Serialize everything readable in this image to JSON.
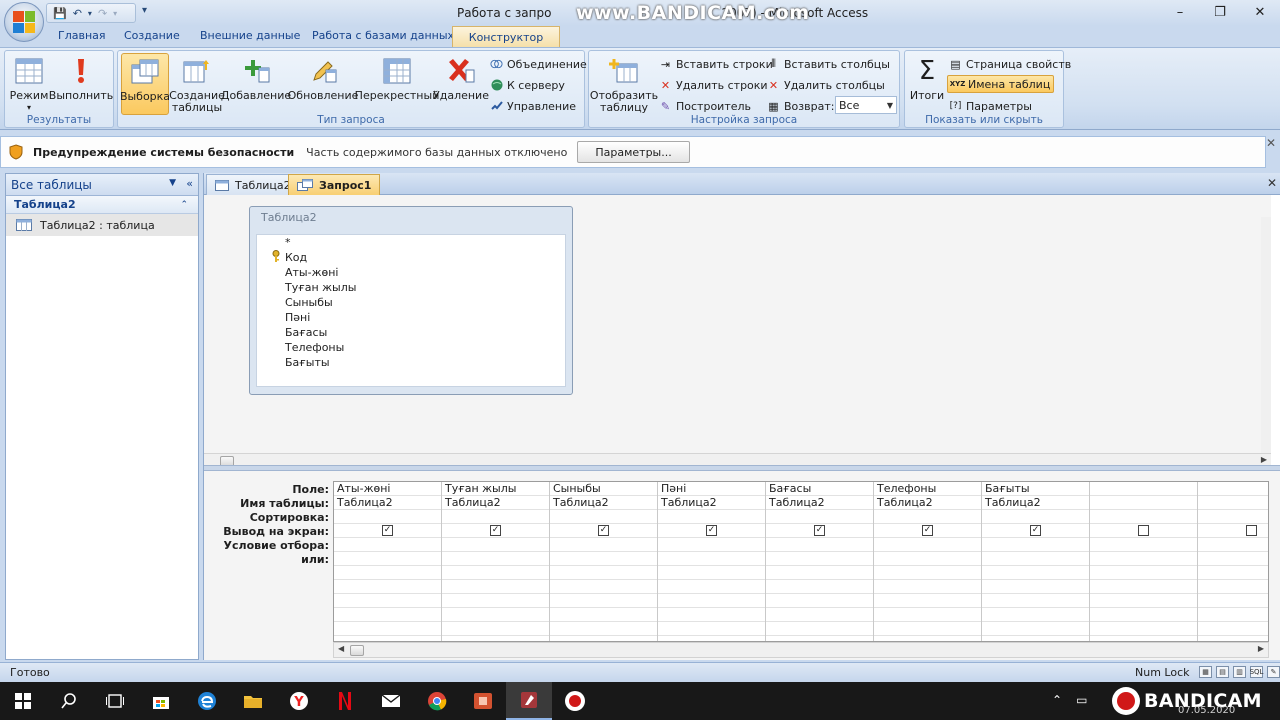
{
  "window": {
    "title": "Работа с запро",
    "title_right": "2007) - Microsoft Access",
    "watermark": "www.BANDICAM.com",
    "controls": [
      "–",
      "❐",
      "✕"
    ]
  },
  "ribbon_tabs": [
    "Главная",
    "Создание",
    "Внешние данные",
    "Работа с базами данных"
  ],
  "context_tab": "Конструктор",
  "groups": {
    "results": {
      "label": "Результаты",
      "view": "Режим",
      "run": "Выполнить"
    },
    "query_type": {
      "label": "Тип запроса",
      "select": "Выборка",
      "make_table": "Создание таблицы",
      "append": "Добавление",
      "update": "Обновление",
      "crosstab": "Перекрестный",
      "delete": "Удаление",
      "union": "Объединение",
      "passthrough": "К серверу",
      "data_def": "Управление"
    },
    "setup": {
      "label": "Настройка запроса",
      "show_table": "Отобразить таблицу",
      "insert_rows": "Вставить строки",
      "delete_rows": "Удалить строки",
      "builder": "Построитель",
      "insert_cols": "Вставить столбцы",
      "delete_cols": "Удалить столбцы",
      "return_label": "Возврат:",
      "return_value": "Все"
    },
    "show_hide": {
      "label": "Показать или скрыть",
      "totals": "Итоги",
      "property_sheet": "Страница свойств",
      "table_names": "Имена таблиц",
      "parameters": "Параметры"
    }
  },
  "security": {
    "title": "Предупреждение системы безопасности",
    "text": "Часть содержимого базы данных отключено",
    "button": "Параметры..."
  },
  "nav": {
    "header": "Все таблицы",
    "group": "Таблица2",
    "item": "Таблица2 : таблица"
  },
  "doc_tabs": [
    "Таблица2",
    "Запрос1"
  ],
  "field_list": {
    "title": "Таблица2",
    "fields": [
      "*",
      "Код",
      "Аты-жөні",
      "Туған жылы",
      "Сыныбы",
      "Пәні",
      "Бағасы",
      "Телефоны",
      "Бағыты"
    ]
  },
  "qbe": {
    "row_labels": [
      "Поле:",
      "Имя таблицы:",
      "Сортировка:",
      "Вывод на экран:",
      "Условие отбора:",
      "или:"
    ],
    "columns": [
      {
        "field": "Аты-жөні",
        "table": "Таблица2",
        "show": true
      },
      {
        "field": "Туған жылы",
        "table": "Таблица2",
        "show": true
      },
      {
        "field": "Сыныбы",
        "table": "Таблица2",
        "show": true
      },
      {
        "field": "Пәні",
        "table": "Таблица2",
        "show": true
      },
      {
        "field": "Бағасы",
        "table": "Таблица2",
        "show": true
      },
      {
        "field": "Телефоны",
        "table": "Таблица2",
        "show": true
      },
      {
        "field": "Бағыты",
        "table": "Таблица2",
        "show": true
      },
      {
        "field": "",
        "table": "",
        "show": false
      },
      {
        "field": "",
        "table": "",
        "show": false
      }
    ]
  },
  "status": {
    "left": "Готово",
    "num_lock": "Num Lock",
    "view_sql": "SQL"
  },
  "taskbar": {
    "bandicam": "BANDICAM",
    "date": "07.05.2020"
  }
}
